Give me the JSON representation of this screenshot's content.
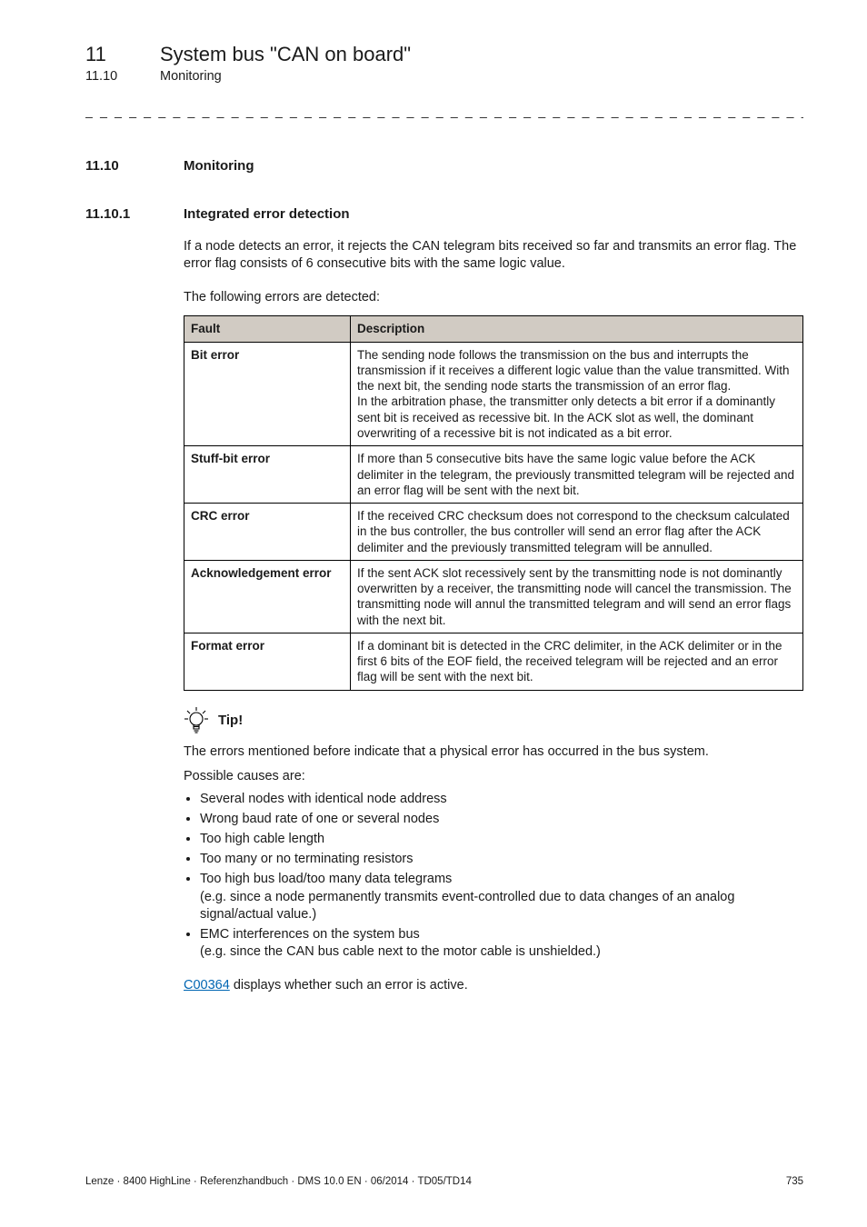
{
  "header": {
    "chapter_num": "11",
    "chapter_title": "System bus \"CAN on board\"",
    "section_num": "11.10",
    "section_title": "Monitoring"
  },
  "h2": {
    "num": "11.10",
    "title": "Monitoring"
  },
  "h3": {
    "num": "11.10.1",
    "title": "Integrated error detection"
  },
  "intro_para": "If a node detects an error, it rejects the CAN telegram bits received so far and transmits an error flag. The error flag consists of 6 consecutive bits with the same logic value.",
  "table_lead": "The following errors are detected:",
  "table": {
    "headers": [
      "Fault",
      "Description"
    ],
    "rows": [
      {
        "label": "Bit error",
        "desc": "The sending node follows the transmission on the bus and interrupts the transmission if it receives a different logic value than the value transmitted. With the next bit, the sending node starts the transmission of an error flag.\nIn the arbitration phase, the transmitter only detects a bit error if a dominantly sent bit is received as recessive bit. In the ACK slot as well, the dominant overwriting of a recessive bit is not indicated as a bit error."
      },
      {
        "label": "Stuff-bit error",
        "desc": "If more than 5 consecutive bits have the same logic value before the ACK delimiter in the telegram, the previously transmitted telegram will be rejected and an error flag will be sent with the next bit."
      },
      {
        "label": "CRC error",
        "desc": "If the received CRC checksum does not correspond to the checksum calculated in the bus controller, the bus controller will send an error flag after the ACK delimiter and the previously transmitted telegram will be annulled."
      },
      {
        "label": "Acknowledgement error",
        "desc": "If the sent ACK slot recessively sent by the transmitting node is not dominantly overwritten by a receiver, the transmitting node will cancel the transmission. The transmitting node will annul the transmitted telegram and will send an error flags with the next bit."
      },
      {
        "label": "Format error",
        "desc": "If a dominant bit is detected in the CRC delimiter, in the ACK delimiter or in the first 6 bits of the EOF field, the received telegram will be rejected and an error flag will be sent with the next bit."
      }
    ]
  },
  "tip": {
    "label": "Tip!",
    "line1": "The errors mentioned before indicate that a physical error has occurred in the bus system.",
    "line2": "Possible causes are:",
    "bullets": [
      "Several nodes with identical node address",
      "Wrong baud rate of one or several nodes",
      "Too high cable length",
      "Too many or no terminating resistors",
      "Too high bus load/too many data telegrams",
      "EMC interferences on the system bus"
    ],
    "sub_bullets": {
      "4": "(e.g. since a node permanently transmits event-controlled due to data changes of an analog signal/actual value.)",
      "5": "(e.g. since the CAN bus cable next to the motor cable is unshielded.)"
    },
    "closing_link_text": "C00364",
    "closing_rest": " displays whether such an error is active."
  },
  "footer": {
    "left": "Lenze · 8400 HighLine · Referenzhandbuch · DMS 10.0 EN · 06/2014 · TD05/TD14",
    "right": "735"
  }
}
